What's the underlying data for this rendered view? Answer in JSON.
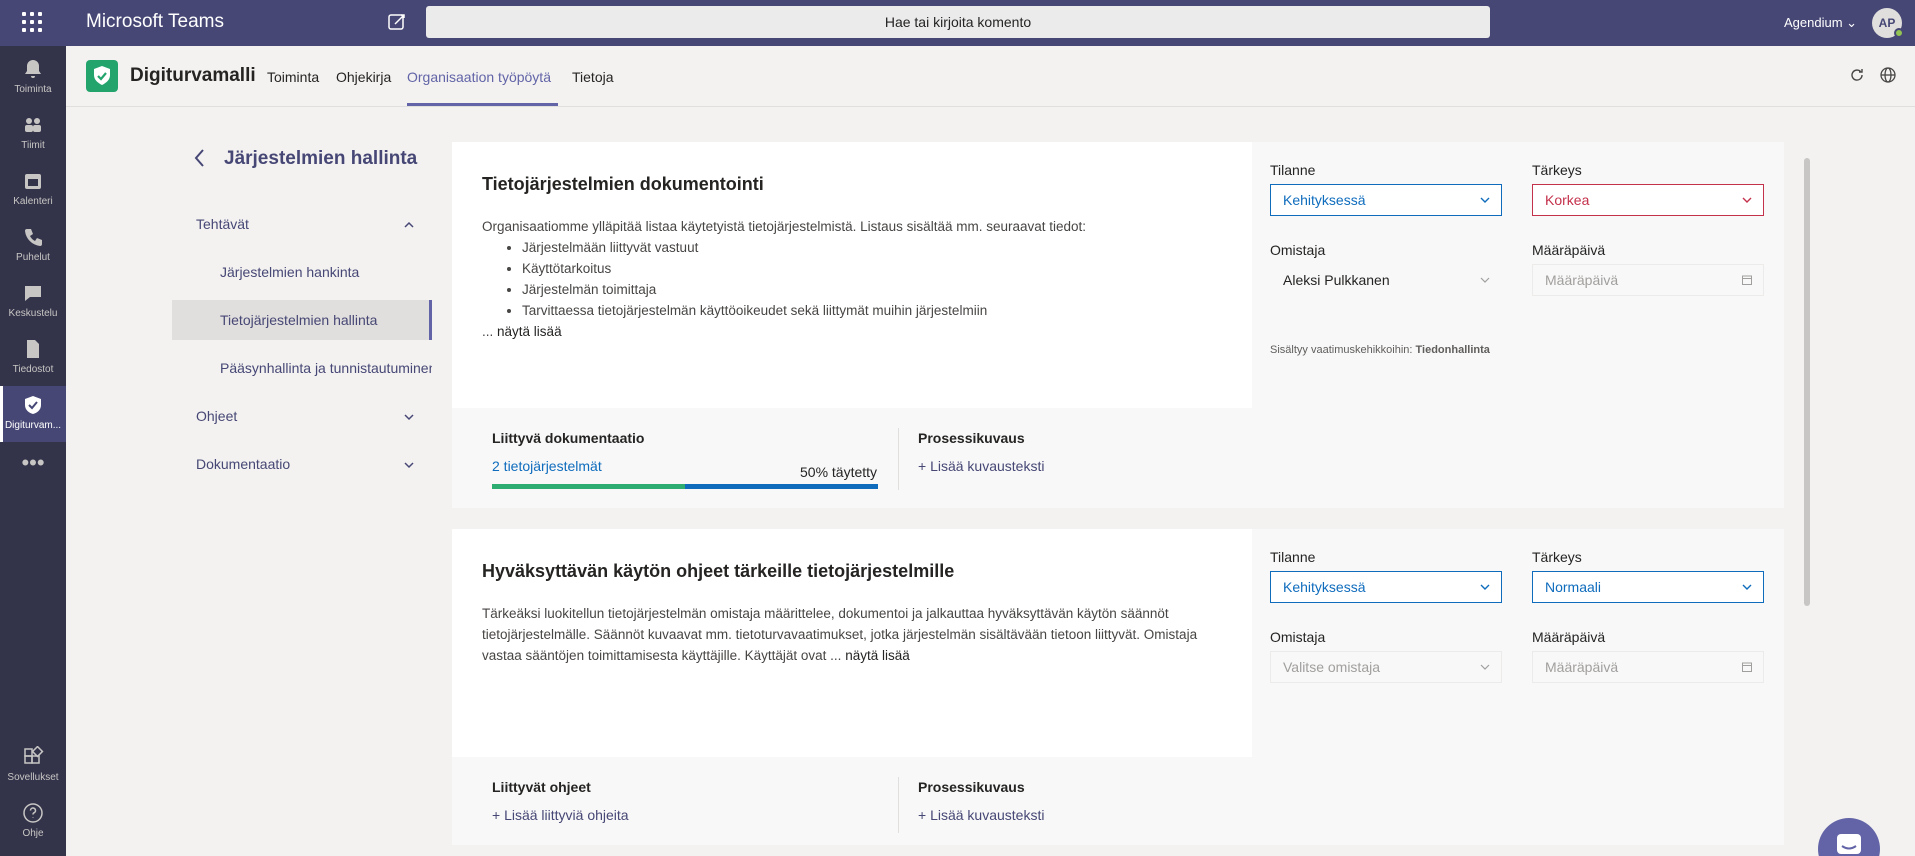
{
  "topbar": {
    "app_title": "Microsoft Teams",
    "search_placeholder": "Hae tai kirjoita komento",
    "org_name": "Agendium",
    "avatar_initials": "AP"
  },
  "rail": {
    "items": [
      {
        "label": "Toiminta",
        "icon": "bell-icon"
      },
      {
        "label": "Tiimit",
        "icon": "teams-icon"
      },
      {
        "label": "Kalenteri",
        "icon": "calendar-icon"
      },
      {
        "label": "Puhelut",
        "icon": "phone-icon"
      },
      {
        "label": "Keskustelu",
        "icon": "chat-icon"
      },
      {
        "label": "Tiedostot",
        "icon": "file-icon"
      },
      {
        "label": "Digiturvam...",
        "icon": "shield-icon"
      },
      {
        "label": "Sovellukset",
        "icon": "apps-icon"
      },
      {
        "label": "Ohje",
        "icon": "help-icon"
      }
    ]
  },
  "app_header": {
    "app_name": "Digiturvamalli",
    "tabs": [
      "Toiminta",
      "Ohjekirja",
      "Organisaation työpöytä",
      "Tietoja"
    ],
    "active_tab": "Organisaation työpöytä"
  },
  "sidebar": {
    "title": "Järjestelmien hallinta",
    "groups": [
      {
        "label": "Tehtävät",
        "expanded": true,
        "items": [
          "Järjestelmien hankinta",
          "Tietojärjestelmien hallinta",
          "Pääsynhallinta ja tunnistautuminen"
        ],
        "active_item": "Tietojärjestelmien hallinta"
      },
      {
        "label": "Ohjeet",
        "expanded": false
      },
      {
        "label": "Dokumentaatio",
        "expanded": false
      }
    ]
  },
  "cards": [
    {
      "title": "Tietojärjestelmien dokumentointi",
      "intro": "Organisaatiomme ylläpitää listaa käytetyistä tietojärjestelmistä. Listaus sisältää mm. seuraavat tiedot:",
      "bullets": [
        "Järjestelmään liittyvät vastuut",
        "Käyttötarkoitus",
        "Järjestelmän toimittaja",
        "Tarvittaessa tietojärjestelmän käyttöoikeudet sekä liittymät muihin järjestelmiin"
      ],
      "show_more_prefix": "...",
      "show_more": "näytä lisää",
      "status_label": "Tilanne",
      "status_value": "Kehityksessä",
      "priority_label": "Tärkeys",
      "priority_value": "Korkea",
      "owner_label": "Omistaja",
      "owner_value": "Aleksi Pulkkanen",
      "due_label": "Määräpäivä",
      "due_placeholder": "Määräpäivä",
      "meta_prefix": "Sisältyy vaatimuskehikkoihin:",
      "meta_value": "Tiedonhallinta",
      "footer": {
        "doc_title": "Liittyvä dokumentaatio",
        "doc_link": "2 tietojärjestelmät",
        "doc_progress_text": "50% täytetty",
        "doc_progress": 0.5,
        "process_title": "Prosessikuvaus",
        "process_link": "+ Lisää kuvausteksti"
      }
    },
    {
      "title": "Hyväksyttävän käytön ohjeet tärkeille tietojärjestelmille",
      "body": "Tärkeäksi luokitellun tietojärjestelmän omistaja määrittelee, dokumentoi ja jalkauttaa hyväksyttävän käytön säännöt tietojärjestelmälle. Säännöt kuvaavat mm. tietoturvavaatimukset, jotka järjestelmän sisältävään tietoon liittyvät. Omistaja vastaa sääntöjen toimittamisesta käyttäjille. Käyttäjät ovat ...",
      "show_more": "näytä lisää",
      "status_label": "Tilanne",
      "status_value": "Kehityksessä",
      "priority_label": "Tärkeys",
      "priority_value": "Normaali",
      "owner_label": "Omistaja",
      "owner_placeholder": "Valitse omistaja",
      "due_label": "Määräpäivä",
      "due_placeholder": "Määräpäivä",
      "footer": {
        "guides_title": "Liittyvät ohjeet",
        "guides_link": "+ Lisää liittyviä ohjeita",
        "process_title": "Prosessikuvaus",
        "process_link": "+ Lisää kuvausteksti"
      }
    }
  ],
  "colors": {
    "teams_purple": "#464775",
    "accent": "#6264a7",
    "status_blue": "#0f6cbd",
    "priority_red": "#c4314b",
    "progress_green": "#2ead72"
  }
}
